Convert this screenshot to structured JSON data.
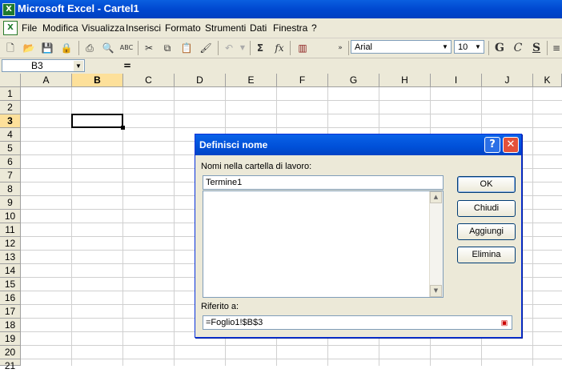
{
  "window": {
    "title": "Microsoft Excel - Cartel1"
  },
  "menu": [
    "File",
    "Modifica",
    "Visualizza",
    "Inserisci",
    "Formato",
    "Strumenti",
    "Dati",
    "Finestra",
    "?"
  ],
  "toolbar": {
    "font": "Arial",
    "size": "10",
    "bold": "G",
    "italic": "C",
    "underline": "S",
    "sum": "Σ",
    "fx": "fx"
  },
  "formula_bar": {
    "name_box": "B3",
    "equals": "="
  },
  "columns": [
    "A",
    "B",
    "C",
    "D",
    "E",
    "F",
    "G",
    "H",
    "I",
    "J",
    "K"
  ],
  "rows": [
    "1",
    "2",
    "3",
    "4",
    "5",
    "6",
    "7",
    "8",
    "9",
    "10",
    "11",
    "12",
    "13",
    "14",
    "15",
    "16",
    "17",
    "18",
    "19",
    "20",
    "21"
  ],
  "selection": {
    "column": "B",
    "row": "3"
  },
  "dialog": {
    "title": "Definisci nome",
    "help": "?",
    "close": "✕",
    "names_label": "Nomi nella cartella di lavoro:",
    "name_value": "Termine1",
    "ok": "OK",
    "close_button": "Chiudi",
    "add": "Aggiungi",
    "delete": "Elimina",
    "ref_label": "Riferito a:",
    "ref_value": "=Foglio1!$B$3"
  }
}
